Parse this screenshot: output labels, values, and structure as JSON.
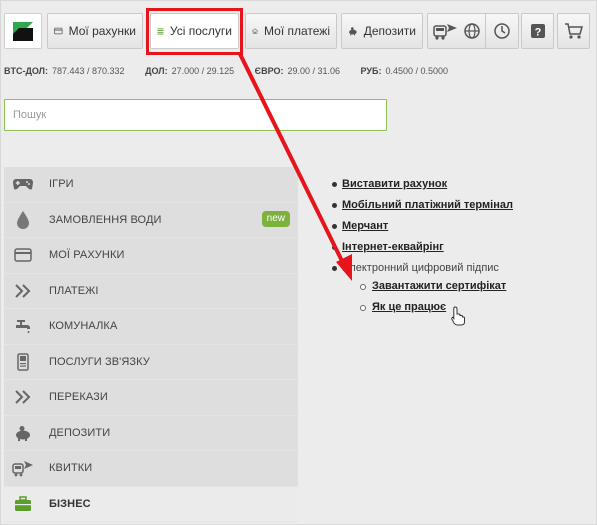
{
  "nav": {
    "tabs": [
      {
        "label": "Мої рахунки"
      },
      {
        "label": "Усі послуги"
      },
      {
        "label": "Мої платежі"
      },
      {
        "label": "Депозити"
      }
    ]
  },
  "rates": [
    {
      "label": "BTC-ДОЛ:",
      "value": "787.443 / 870.332"
    },
    {
      "label": "ДОЛ:",
      "value": "27.000 / 29.125"
    },
    {
      "label": "ЄВРО:",
      "value": "29.00 / 31.06"
    },
    {
      "label": "РУБ:",
      "value": "0.4500 / 0.5000"
    }
  ],
  "search": {
    "placeholder": "Пошук"
  },
  "menu": [
    {
      "label": "ІГРИ",
      "icon": "gamepad-icon"
    },
    {
      "label": "ЗАМОВЛЕННЯ ВОДИ",
      "icon": "water-drop-icon",
      "badge": "new"
    },
    {
      "label": "МОЇ РАХУНКИ",
      "icon": "card-icon"
    },
    {
      "label": "ПЛАТЕЖІ",
      "icon": "double-chevron-icon"
    },
    {
      "label": "КОМУНАЛКА",
      "icon": "faucet-icon"
    },
    {
      "label": "ПОСЛУГИ ЗВ'ЯЗКУ",
      "icon": "phone-icon"
    },
    {
      "label": "ПЕРЕКАЗИ",
      "icon": "double-chevron-icon"
    },
    {
      "label": "ДЕПОЗИТИ",
      "icon": "piggy-bank-icon"
    },
    {
      "label": "КВИТКИ",
      "icon": "transport-icon"
    },
    {
      "label": "БІЗНЕС",
      "icon": "briefcase-icon",
      "active": true
    }
  ],
  "content": {
    "links": [
      "Виставити рахунок",
      "Мобільний платіжний термінал",
      "Мерчант",
      "Інтернет-еквайрінг"
    ],
    "signature": {
      "label": "Електронний цифровий підпис",
      "sublinks": [
        "Завантажити сертифікат",
        "Як це працює"
      ]
    }
  },
  "colors": {
    "accent_green": "#7bb13c",
    "annotation_red": "#e8141c",
    "logo_green": "#2fa84f"
  }
}
